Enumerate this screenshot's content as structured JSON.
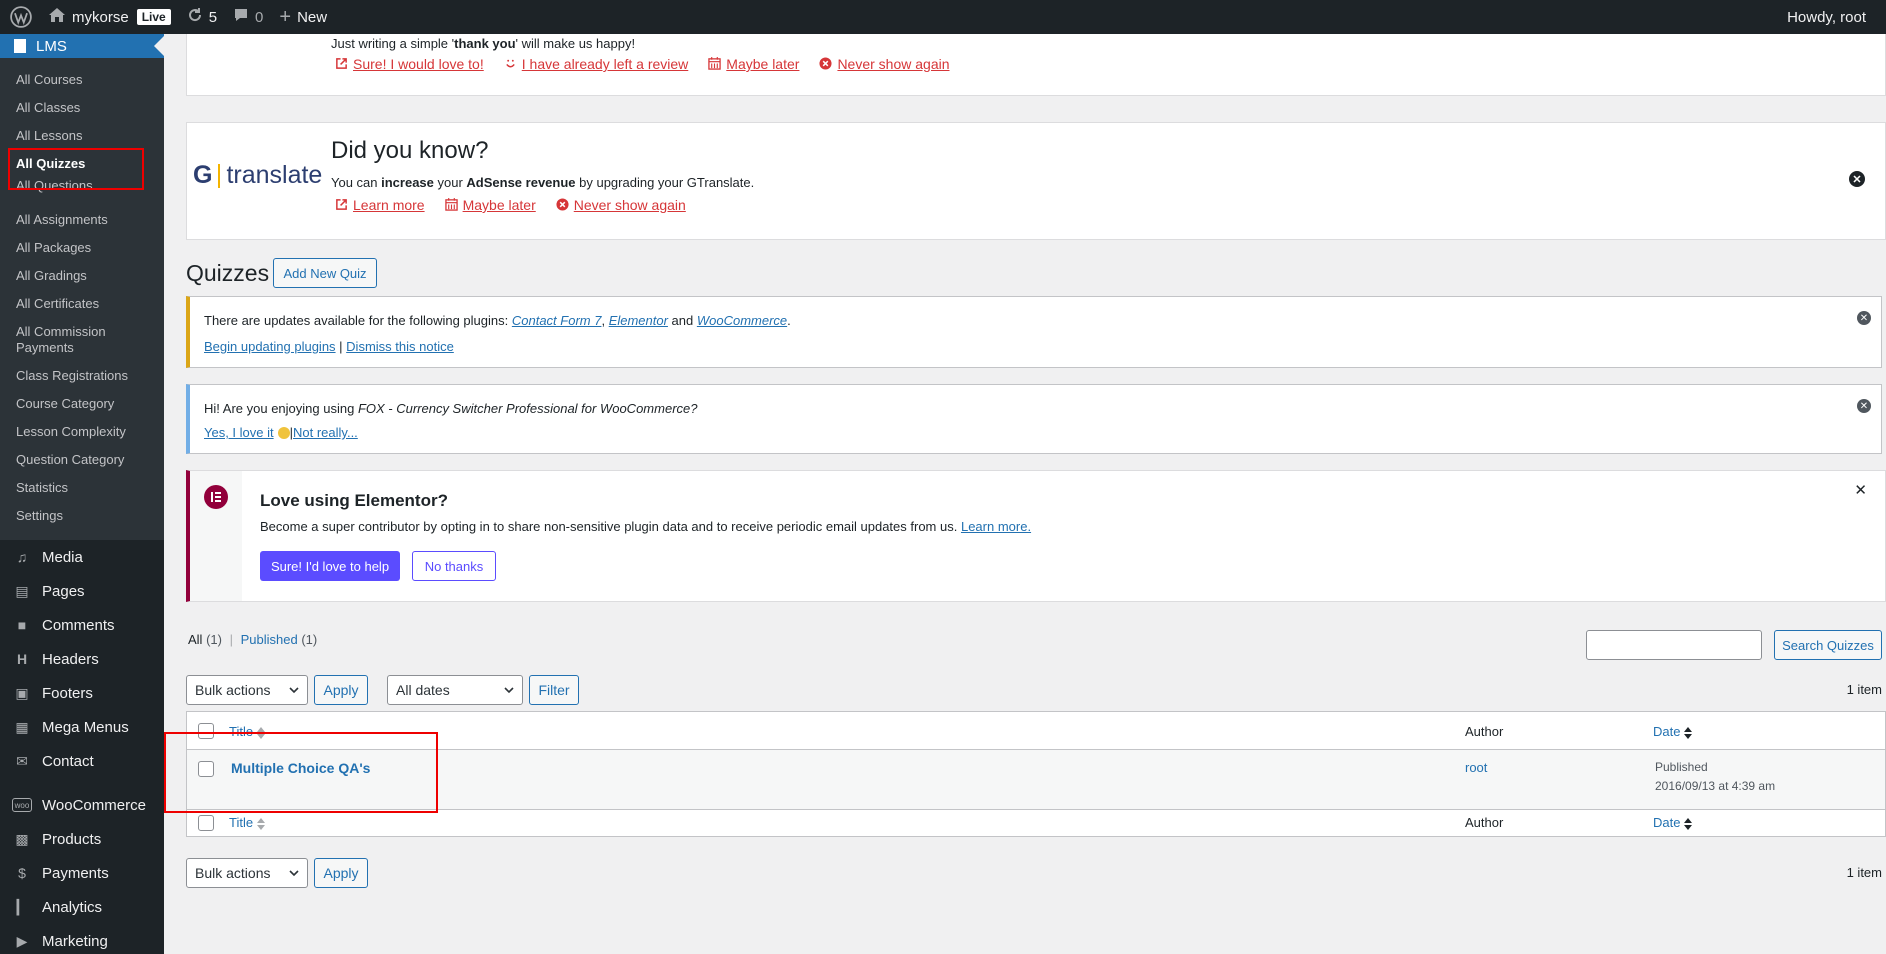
{
  "adminbar": {
    "site_name": "mykorse",
    "live_badge": "Live",
    "updates_count": "5",
    "comments_count": "0",
    "new_label": "New",
    "howdy": "Howdy, root"
  },
  "sidebar": {
    "lms_label": "LMS",
    "submenu": [
      "All Courses",
      "All Classes",
      "All Lessons",
      "All Quizzes",
      "All Questions",
      "All Assignments",
      "All Packages",
      "All Gradings",
      "All Certificates",
      "All Commission Payments",
      "Class Registrations",
      "Course Category",
      "Lesson Complexity",
      "Question Category",
      "Statistics",
      "Settings"
    ],
    "menu": [
      {
        "label": "Media",
        "icon": "media-icon"
      },
      {
        "label": "Pages",
        "icon": "pages-icon"
      },
      {
        "label": "Comments",
        "icon": "comments-icon"
      },
      {
        "label": "Headers",
        "icon": "headers-icon"
      },
      {
        "label": "Footers",
        "icon": "footers-icon"
      },
      {
        "label": "Mega Menus",
        "icon": "mega-menus-icon"
      },
      {
        "label": "Contact",
        "icon": "contact-icon"
      },
      {
        "label": "WooCommerce",
        "icon": "woocommerce-icon"
      },
      {
        "label": "Products",
        "icon": "products-icon"
      },
      {
        "label": "Payments",
        "icon": "payments-icon"
      },
      {
        "label": "Analytics",
        "icon": "analytics-icon"
      },
      {
        "label": "Marketing",
        "icon": "marketing-icon"
      }
    ]
  },
  "review_notice": {
    "text_pre": "Just writing a simple '",
    "text_bold": "thank you",
    "text_post": "' will make us happy!",
    "links": [
      "Sure! I would love to!",
      "I have already left a review",
      "Maybe later",
      "Never show again"
    ]
  },
  "gtranslate_notice": {
    "logo_g": "G",
    "logo_text": "translate",
    "title": "Did you know?",
    "text_1": "You can ",
    "text_bold_1": "increase",
    "text_2": " your ",
    "text_bold_2": "AdSense revenue",
    "text_3": " by upgrading your GTranslate.",
    "links": [
      "Learn more",
      "Maybe later",
      "Never show again"
    ]
  },
  "page": {
    "title": "Quizzes",
    "add_new": "Add New Quiz"
  },
  "updates_notice": {
    "text_pre": "There are updates available for the following plugins: ",
    "plugin_1": "Contact Form 7",
    "sep_1": ", ",
    "plugin_2": "Elementor",
    "sep_2": " and ",
    "plugin_3": "WooCommerce",
    "end": ".",
    "begin_link": "Begin updating plugins",
    "pipe": " | ",
    "dismiss_link": "Dismiss this notice"
  },
  "fox_notice": {
    "text_pre": "Hi! Are you enjoying using ",
    "text_em": "FOX - Currency Switcher Professional for WooCommerce?",
    "yes_link": "Yes, I love it",
    "pipe": " | ",
    "no_link": "Not really..."
  },
  "elementor_notice": {
    "title": "Love using Elementor?",
    "text": "Become a super contributor by opting in to share non-sensitive plugin data and to receive periodic email updates from us.",
    "learn_more": "Learn more.",
    "primary_button": "Sure! I'd love to help",
    "secondary_button": "No thanks"
  },
  "filters": {
    "all_label": "All",
    "all_count": "(1)",
    "sep": "|",
    "published_label": "Published",
    "published_count": "(1)",
    "search_button": "Search Quizzes",
    "search_value": "",
    "bulk_actions": "Bulk actions",
    "apply": "Apply",
    "all_dates": "All dates",
    "filter": "Filter",
    "items_count": "1 item"
  },
  "table": {
    "columns": {
      "title": "Title",
      "author": "Author",
      "date": "Date"
    },
    "rows": [
      {
        "title": "Multiple Choice QA's",
        "author": "root",
        "status": "Published",
        "date": "2016/09/13 at 4:39 am"
      }
    ]
  },
  "colors": {
    "admin_bar": "#1d2327",
    "accent_blue": "#2271b1",
    "notice_red": "#d63638",
    "elementor_brand": "#92003b",
    "elementor_button": "#5b4cff",
    "highlight_box": "#e00000"
  }
}
